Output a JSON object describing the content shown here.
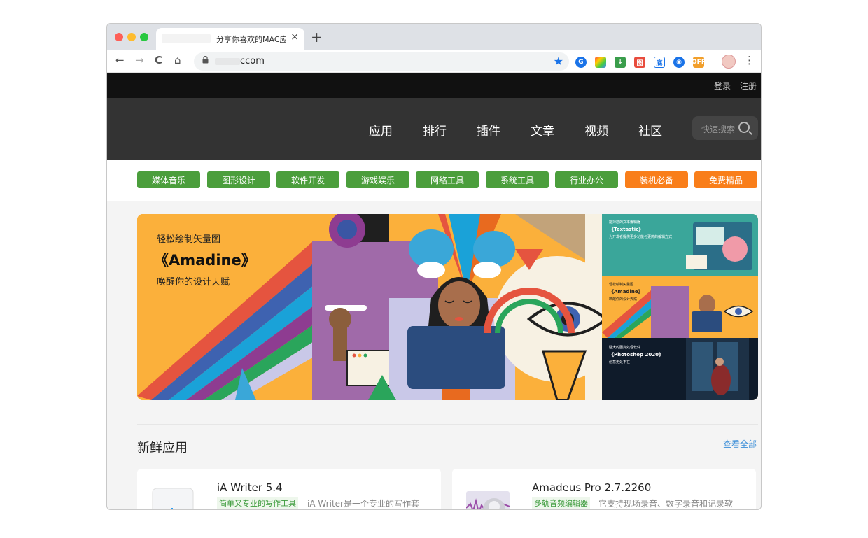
{
  "browser": {
    "tab_title": "分享你喜欢的MAC应",
    "tab_close": "×",
    "new_tab": "+",
    "url_text": "ccom",
    "nav": {
      "back": "←",
      "forward": "→",
      "reload": "C",
      "home": "⌂"
    },
    "star": "★",
    "menu": "⋮"
  },
  "site": {
    "auth": {
      "login": "登录",
      "register": "注册"
    },
    "nav": [
      "应用",
      "排行",
      "插件",
      "文章",
      "视频",
      "社区"
    ],
    "search_placeholder": "快速搜索",
    "categories": [
      {
        "label": "媒体音乐",
        "color": "green"
      },
      {
        "label": "图形设计",
        "color": "green"
      },
      {
        "label": "软件开发",
        "color": "green"
      },
      {
        "label": "游戏娱乐",
        "color": "green"
      },
      {
        "label": "网络工具",
        "color": "green"
      },
      {
        "label": "系统工具",
        "color": "green"
      },
      {
        "label": "行业办公",
        "color": "green"
      },
      {
        "label": "装机必备",
        "color": "orange"
      },
      {
        "label": "免费精品",
        "color": "orange"
      }
    ],
    "banner": {
      "subtitle": "轻松绘制矢量图",
      "title": "《Amadine》",
      "tagline": "唤醒你的设计天赋",
      "side": [
        {
          "small": "能对您的文本编辑器",
          "name": "《Textastic》",
          "desc": "为开发者提供更多功能与更简的编辑方式"
        },
        {
          "small": "轻松绘制矢量图",
          "name": "《Amadine》",
          "desc": "唤醒你的设计天赋"
        },
        {
          "small": "强大的图片处理软件",
          "name": "《Photoshop 2020》",
          "desc": "创意无处不在"
        }
      ]
    },
    "section": {
      "title": "新鲜应用",
      "view_all": "查看全部"
    },
    "apps": [
      {
        "name": "iA Writer 5.4",
        "tag": "简单又专业的写作工具",
        "desc": "iA Writer是一个专业的写作套"
      },
      {
        "name": "Amadeus Pro 2.7.2260",
        "tag": "多轨音频编辑器",
        "desc": "它支持现场录音、数字录音和记录软"
      }
    ]
  },
  "colors": {
    "green": "#4b9e3c",
    "orange": "#f97e1a",
    "header_dark": "#333333",
    "topbar": "#111111",
    "link_blue": "#3b8ed8"
  }
}
